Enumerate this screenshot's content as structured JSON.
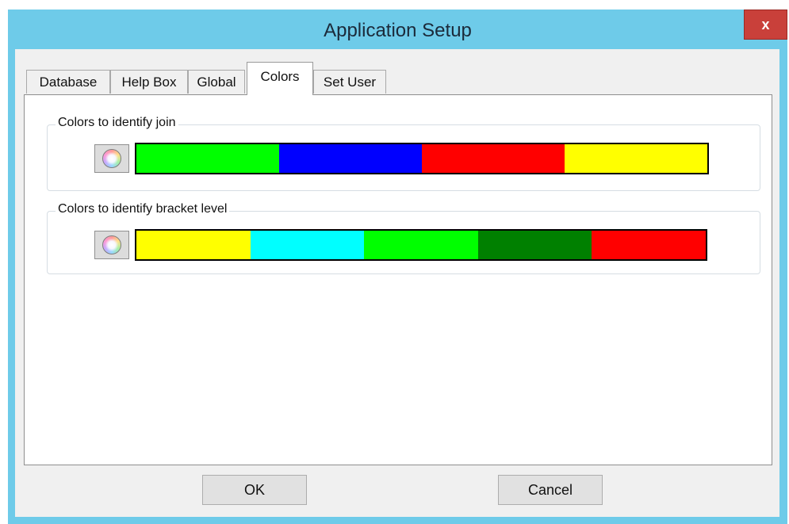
{
  "window": {
    "title": "Application Setup",
    "close_label": "x"
  },
  "tabs": [
    {
      "label": "Database",
      "active": false
    },
    {
      "label": "Help Box",
      "active": false
    },
    {
      "label": "Global",
      "active": false
    },
    {
      "label": "Colors",
      "active": true
    },
    {
      "label": "Set User",
      "active": false
    }
  ],
  "groups": {
    "join": {
      "label": "Colors to identify join",
      "colors": [
        "#00ff00",
        "#0000ff",
        "#ff0000",
        "#ffff00"
      ]
    },
    "bracket": {
      "label": "Colors to identify bracket level",
      "colors": [
        "#ffff00",
        "#00ffff",
        "#00ff00",
        "#008000",
        "#ff0000"
      ]
    }
  },
  "buttons": {
    "ok": "OK",
    "cancel": "Cancel"
  },
  "icons": {
    "color_picker": "color-wheel-icon"
  }
}
